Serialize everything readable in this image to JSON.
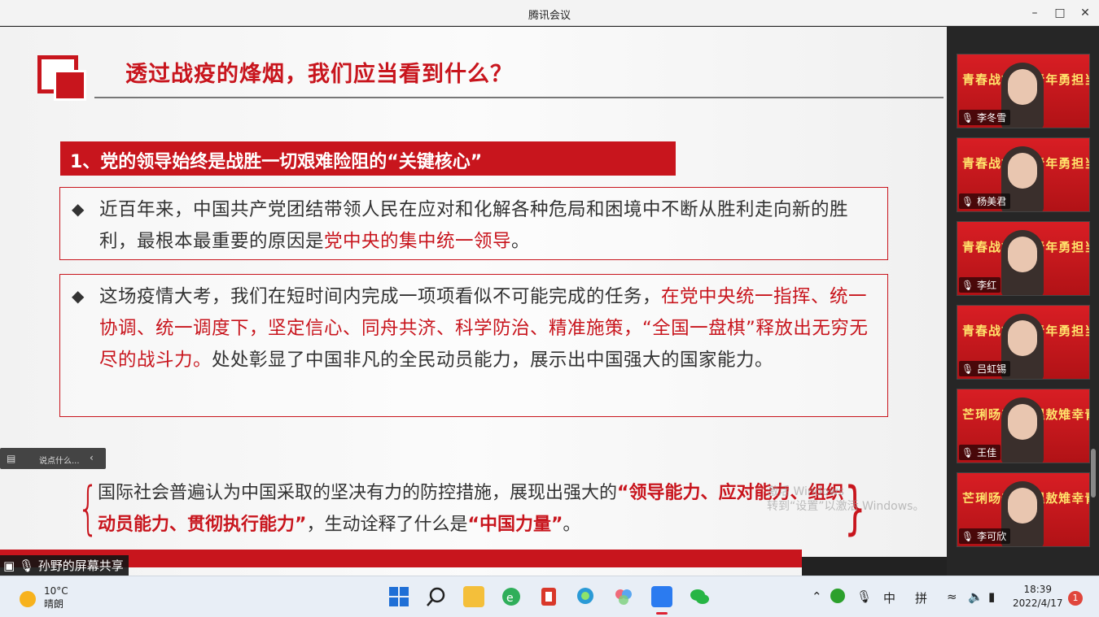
{
  "window": {
    "title": "腾讯会议"
  },
  "slide": {
    "title": "透过战疫的烽烟，我们应当看到什么？",
    "section_heading": "1、党的领导始终是战胜一切艰难险阻的“关键核心”",
    "box1": {
      "text": "近百年来，中国共产党团结带领人民在应对和化解各种危局和困境中不断从胜利走向新的胜利，最根本最重要的原因是",
      "highlight": "党中央的集中统一领导",
      "end": "。"
    },
    "box2": {
      "text": "这场疫情大考，我们在短时间内完成一项项看似不可能完成的任务，",
      "highlight": "在党中央统一指挥、统一协调、统一调度下，坚定信心、同舟共济、科学防治、精准施策，“全国一盘棋”释放出无穷无尽的战斗力。",
      "end": "处处彰显了中国非凡的全民动员能力，展示出中国强大的国家能力。"
    },
    "bottom": {
      "part1": "国际社会普遍认为中国采取的坚决有力的防控措施，展现出强大的",
      "bold1": "“领导能力、应对能力、组织动员能力、贯彻执行能力”",
      "part2": "，生动诠释了什么是",
      "bold2": "“中国力量”",
      "end": "。"
    },
    "watermark_line1": "激活 Windows",
    "watermark_line2": "转到“设置”以激活 Windows。"
  },
  "overlay": {
    "speak_placeholder": "说点什么...",
    "sharing_label": "孙野的屏幕共享"
  },
  "participants": [
    {
      "name": "李冬雪",
      "banner": "青春战疫路 青年勇担当"
    },
    {
      "name": "杨美君",
      "banner": "青春战疫路 青年勇担当"
    },
    {
      "name": "李红",
      "banner": "青春战疫路 青年勇担当"
    },
    {
      "name": "吕虹锡",
      "banner": "青春战疫路 青年勇担当"
    },
    {
      "name": "王佳",
      "banner": "芒琍旸卆青 褞敖雉幸青"
    },
    {
      "name": "李可欣",
      "banner": "芒琍旸卆青 褞敖雉幸青"
    }
  ],
  "taskbar": {
    "temperature": "10°C",
    "weather": "晴朗",
    "ime1": "中",
    "ime2": "拼",
    "time": "18:39",
    "date": "2022/4/17",
    "notifications": "1"
  }
}
